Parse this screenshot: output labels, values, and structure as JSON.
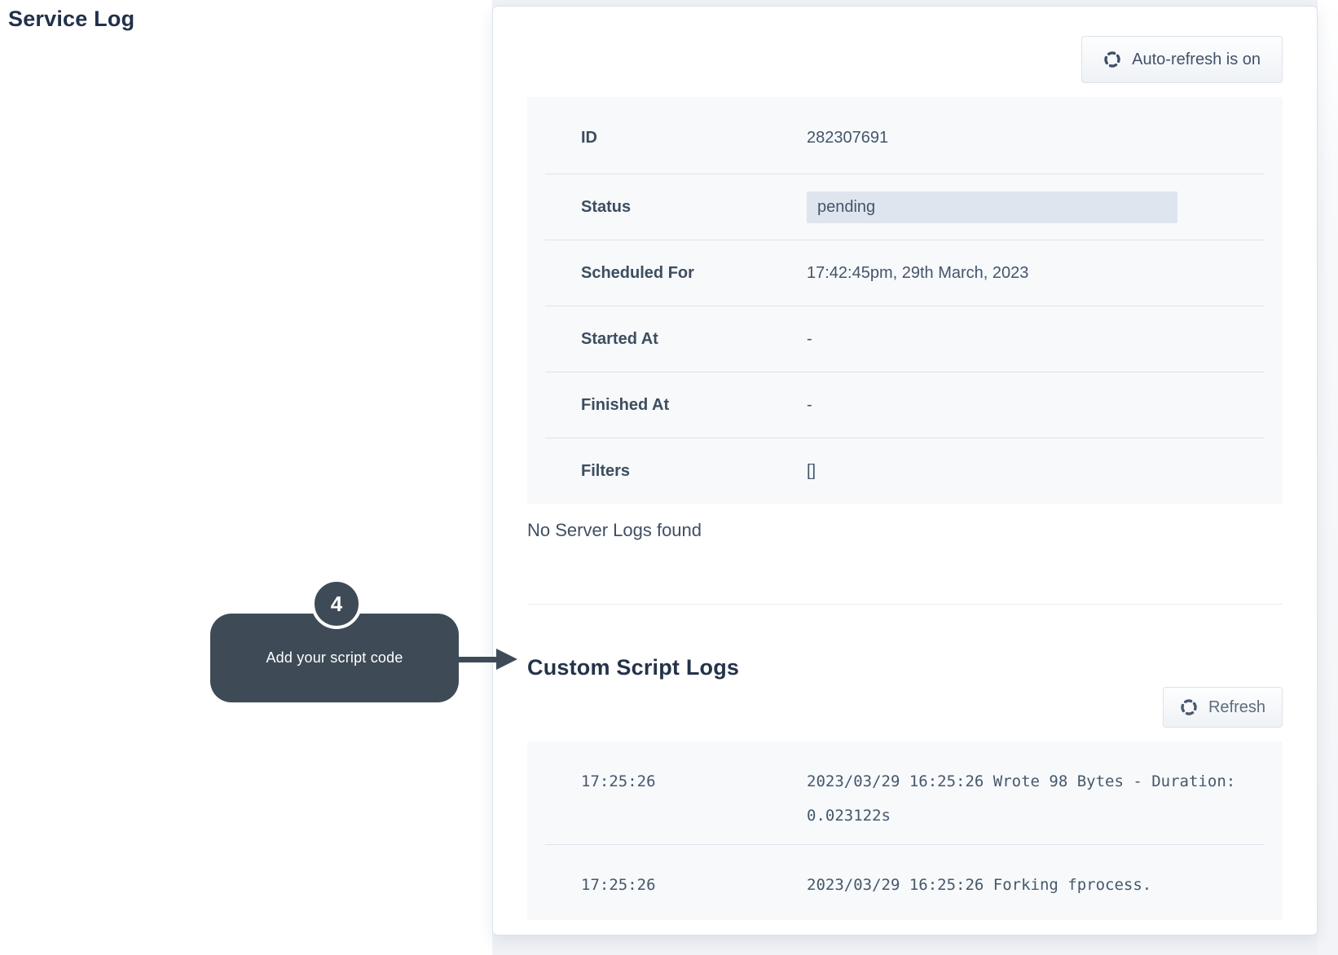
{
  "page": {
    "title": "Service Log"
  },
  "panel": {
    "auto_refresh_button": {
      "label": "Auto-refresh is on",
      "icon": "refresh-spinner-icon"
    },
    "details": {
      "rows": [
        {
          "label": "ID",
          "value": "282307691"
        },
        {
          "label": "Status",
          "value": "pending",
          "highlighted": true
        },
        {
          "label": "Scheduled For",
          "value": "17:42:45pm, 29th March, 2023"
        },
        {
          "label": "Started At",
          "value": "-"
        },
        {
          "label": "Finished At",
          "value": "-"
        },
        {
          "label": "Filters",
          "value": "[]"
        }
      ]
    },
    "server_logs_empty": "No Server Logs found",
    "custom_logs": {
      "heading": "Custom Script Logs",
      "refresh_button": {
        "label": "Refresh",
        "icon": "refresh-spinner-icon"
      },
      "rows": [
        {
          "time": "17:25:26",
          "message": "2023/03/29 16:25:26 Wrote 98 Bytes - Duration: 0.023122s"
        },
        {
          "time": "17:25:26",
          "message": "2023/03/29 16:25:26 Forking fprocess."
        }
      ]
    }
  },
  "callout": {
    "step": "4",
    "label": "Add your script code"
  },
  "colors": {
    "status_highlight_bg": "#dee5ee",
    "callout_bg": "#3e4b57",
    "table_bg": "#f7f9fb",
    "heading_text": "#24334a",
    "body_text": "#44556a"
  }
}
